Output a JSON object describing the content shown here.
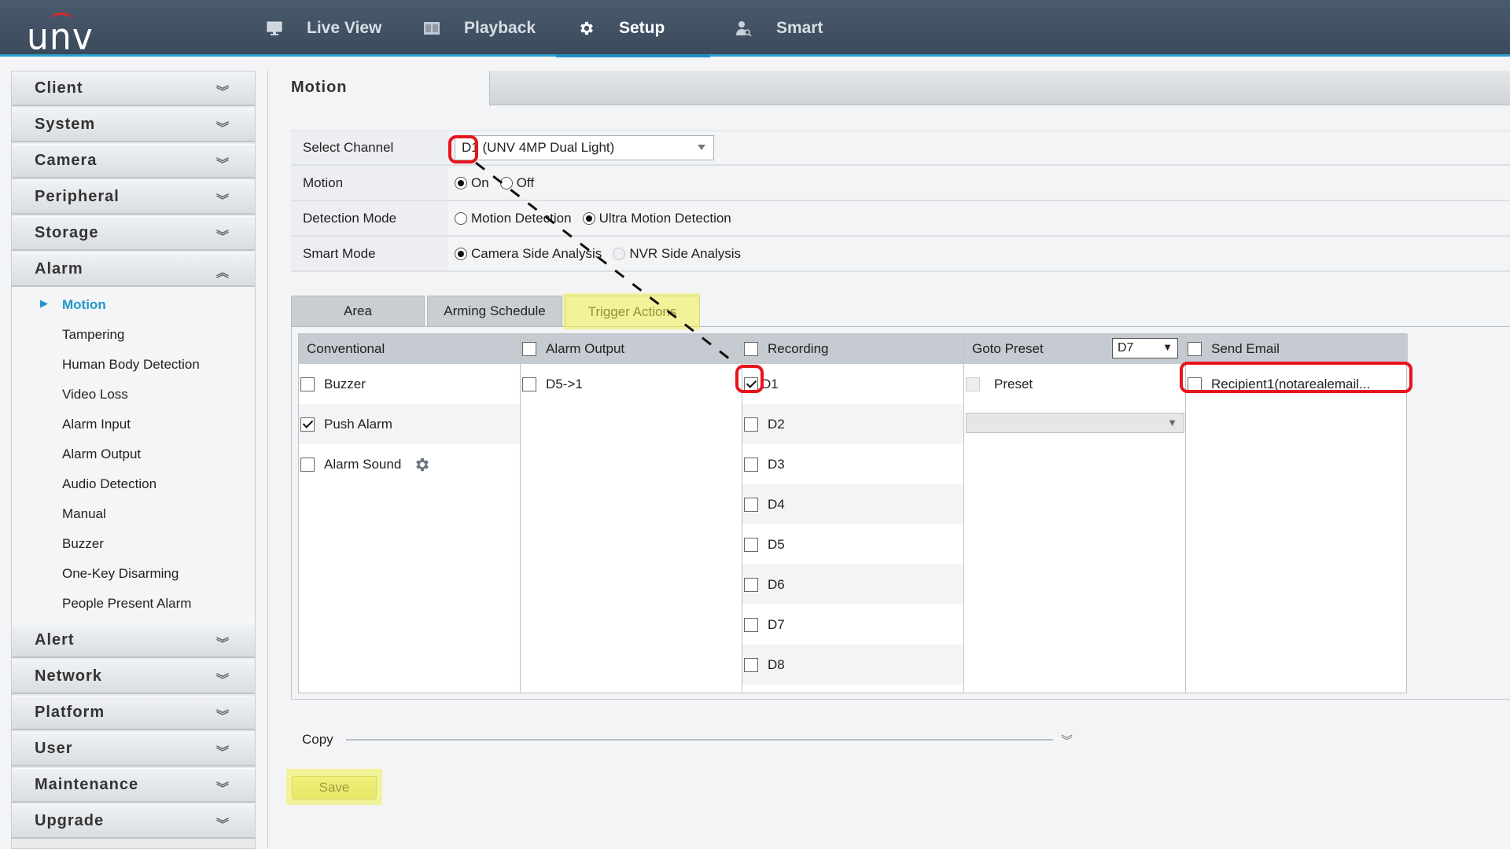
{
  "topbar": {
    "logo": "unv",
    "nav": [
      {
        "label": "Live View",
        "icon": "monitor-icon",
        "active": false
      },
      {
        "label": "Playback",
        "icon": "film-icon",
        "active": false
      },
      {
        "label": "Setup",
        "icon": "gear-icon",
        "active": true
      },
      {
        "label": "Smart",
        "icon": "person-search-icon",
        "active": false
      }
    ]
  },
  "sidebar": {
    "groups_top": [
      "Client",
      "System",
      "Camera",
      "Peripheral",
      "Storage"
    ],
    "expanded_group": {
      "label": "Alarm",
      "items": [
        "Motion",
        "Tampering",
        "Human Body Detection",
        "Video Loss",
        "Alarm Input",
        "Alarm Output",
        "Audio Detection",
        "Manual",
        "Buzzer",
        "One-Key Disarming",
        "People Present Alarm"
      ],
      "active_item": "Motion"
    },
    "groups_bottom": [
      "Alert",
      "Network",
      "Platform",
      "User",
      "Maintenance",
      "Upgrade"
    ]
  },
  "main": {
    "page_tab": "Motion",
    "form": {
      "select_channel": {
        "label": "Select Channel",
        "value": "D1 (UNV 4MP Dual Light)"
      },
      "motion": {
        "label": "Motion",
        "options": [
          "On",
          "Off"
        ],
        "selected": "On"
      },
      "detection_mode": {
        "label": "Detection Mode",
        "options": [
          "Motion Detection",
          "Ultra Motion Detection"
        ],
        "selected": "Ultra Motion Detection"
      },
      "smart_mode": {
        "label": "Smart Mode",
        "options": [
          "Camera Side Analysis",
          "NVR Side Analysis"
        ],
        "selected": "Camera Side Analysis",
        "disabled": [
          "NVR Side Analysis"
        ]
      }
    },
    "subtabs": [
      "Area",
      "Arming Schedule",
      "Trigger Actions"
    ],
    "active_subtab": "Trigger Actions",
    "trigger": {
      "conventional": {
        "header": "Conventional",
        "items": [
          {
            "label": "Buzzer",
            "checked": false
          },
          {
            "label": "Push Alarm",
            "checked": true
          },
          {
            "label": "Alarm Sound",
            "checked": false,
            "icon": "gear-icon"
          }
        ]
      },
      "alarm_output": {
        "header": "Alarm Output",
        "header_checked": false,
        "items": [
          {
            "label": "D5->1",
            "checked": false
          }
        ]
      },
      "recording": {
        "header": "Recording",
        "header_checked": false,
        "items": [
          {
            "label": "D1",
            "checked": true
          },
          {
            "label": "D2",
            "checked": false
          },
          {
            "label": "D3",
            "checked": false
          },
          {
            "label": "D4",
            "checked": false
          },
          {
            "label": "D5",
            "checked": false
          },
          {
            "label": "D6",
            "checked": false
          },
          {
            "label": "D7",
            "checked": false
          },
          {
            "label": "D8",
            "checked": false
          }
        ]
      },
      "goto_preset": {
        "header": "Goto Preset",
        "channel_select": "D7",
        "preset_label": "Preset",
        "preset_checked": false,
        "preset_value": ""
      },
      "send_email": {
        "header": "Send Email",
        "header_checked": false,
        "items": [
          {
            "label": "Recipient1(notarealemail...",
            "checked": false
          }
        ]
      }
    },
    "copy_label": "Copy",
    "save_label": "Save"
  }
}
